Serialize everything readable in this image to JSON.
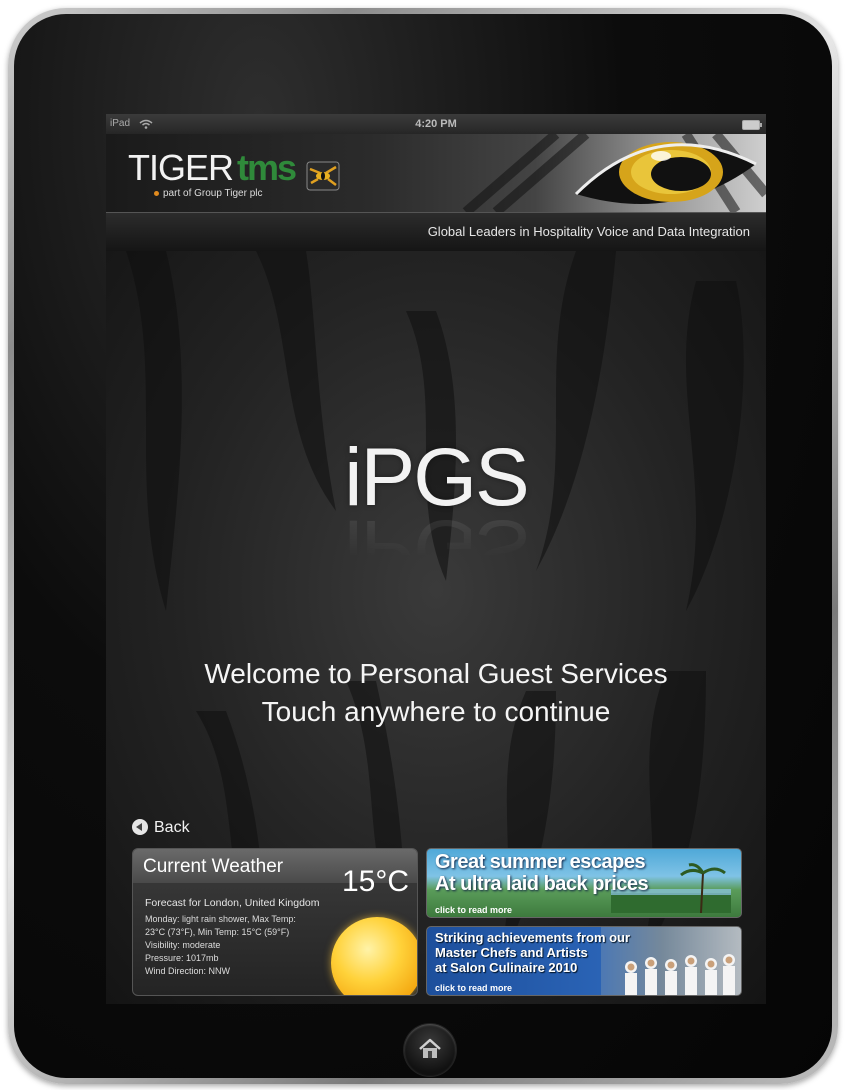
{
  "status_bar": {
    "carrier": "iPad",
    "time": "4:20 PM"
  },
  "header": {
    "logo_tiger": "TIGER",
    "logo_tms": "tms",
    "logo_subtitle": "part of Group Tiger plc",
    "tagline": "Global Leaders in Hospitality Voice and Data Integration"
  },
  "main": {
    "app_title": "iPGS",
    "welcome_line1": "Welcome to Personal Guest Services",
    "welcome_line2": "Touch anywhere to continue",
    "back_label": "Back"
  },
  "weather": {
    "title": "Current Weather",
    "temperature": "15",
    "temperature_unit": "°C",
    "forecast_location": "Forecast for London, United Kingdom",
    "details": [
      "Monday: light rain shower, Max Temp:",
      "23°C (73°F), Min Temp: 15°C (59°F)",
      "Visibility: moderate",
      "Pressure: 1017mb",
      "Wind Direction: NNW"
    ]
  },
  "promos": [
    {
      "line1": "Great summer escapes",
      "line2": "At ultra laid back prices",
      "link": "click to read more"
    },
    {
      "line1": "Striking achievements from our",
      "line2": "Master Chefs and Artists",
      "line3": "at Salon Culinaire 2010",
      "link": "click to read more"
    }
  ],
  "colors": {
    "brand_green": "#2f8a3a",
    "accent_orange": "#e08a1e",
    "screen_bg": "#1a1a1a"
  },
  "icons": [
    "wifi-icon",
    "battery-icon",
    "tiger-eye-logo-icon",
    "back-arrow-icon",
    "sun-icon",
    "home-icon"
  ]
}
